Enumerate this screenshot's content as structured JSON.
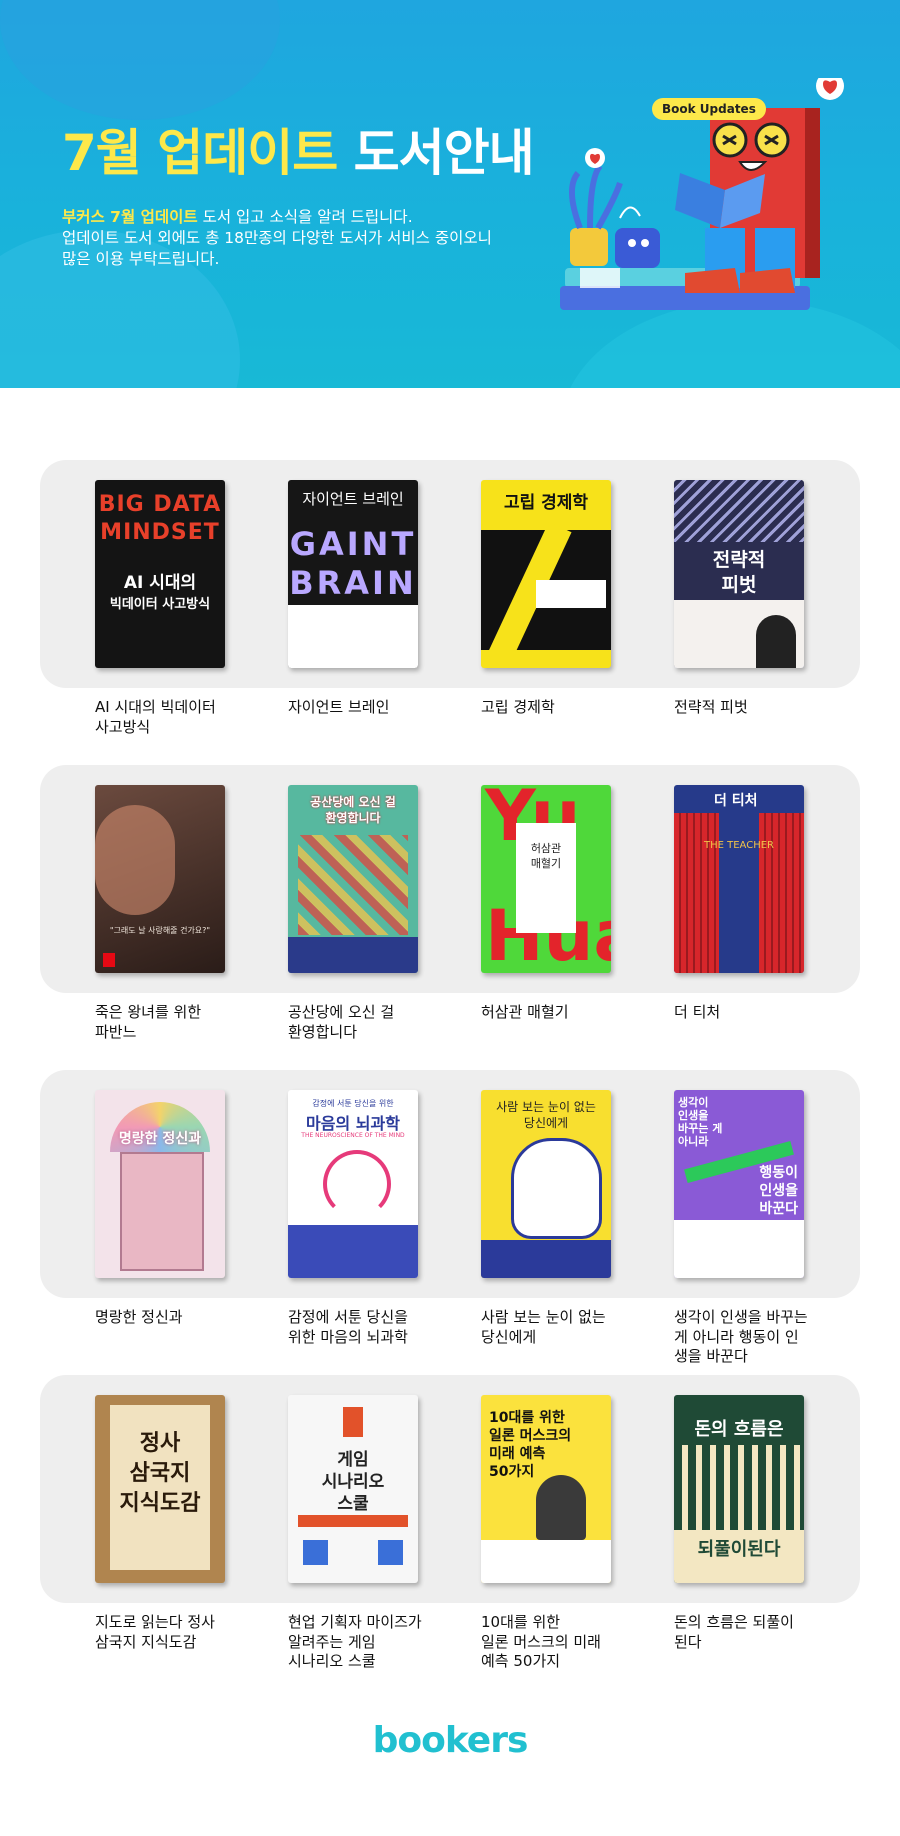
{
  "header": {
    "title_highlight": "7월 업데이트",
    "title_rest": "도서안내",
    "badge": "Book Updates",
    "intro_highlight": "부커스 7월 업데이트",
    "intro_line1_rest": " 도서 입고 소식을 알려 드립니다.",
    "intro_line2": "업데이트 도서 외에도 총 18만종의 다양한 도서가 서비스 중이오니",
    "intro_line3": "많은 이용 부탁드립니다."
  },
  "books": [
    {
      "title_lines": [
        "AI 시대의 빅데이터",
        "사고방식"
      ],
      "cover_text": [
        "BIG DATA",
        "MINDSET",
        "AI 시대의",
        "빅데이터 사고방식"
      ],
      "colors": {
        "bg": "#141414",
        "accent": "#e8402a",
        "text": "#ffffff"
      }
    },
    {
      "title_lines": [
        "자이언트 브레인"
      ],
      "cover_text": [
        "자이언트 브레인",
        "GAINT",
        "BRAIN"
      ],
      "colors": {
        "bg": "#161616",
        "accent": "#a8a8ff",
        "text": "#ffffff"
      }
    },
    {
      "title_lines": [
        "고립 경제학"
      ],
      "cover_text": [
        "고립 경제학"
      ],
      "colors": {
        "bg": "#f7e21a",
        "accent": "#111111",
        "text": "#111111"
      }
    },
    {
      "title_lines": [
        "전략적 피벗"
      ],
      "cover_text": [
        "전략적",
        "피벗"
      ],
      "colors": {
        "bg": "#2b2d50",
        "accent": "#c9c9e8",
        "text": "#ffffff"
      }
    },
    {
      "title_lines": [
        "죽은 왕녀를 위한",
        "파반느"
      ],
      "cover_text": [
        "\"그래도 날 사랑해줄 건가요?\""
      ],
      "colors": {
        "bg": "#3a2a26",
        "accent": "#c87a5a",
        "text": "#f0e6dc"
      }
    },
    {
      "title_lines": [
        "공산당에 오신 걸",
        "환영합니다"
      ],
      "cover_text": [
        "공산당에 오신 걸",
        "환영합니다"
      ],
      "colors": {
        "bg": "#57b89f",
        "accent": "#e1453d",
        "text": "#ffffff"
      }
    },
    {
      "title_lines": [
        "허삼관 매혈기"
      ],
      "cover_text": [
        "Yu",
        "Hua",
        "허삼관",
        "매혈기"
      ],
      "colors": {
        "bg": "#4fd83a",
        "accent": "#e3242b",
        "text": "#222222"
      }
    },
    {
      "title_lines": [
        "더 티처"
      ],
      "cover_text": [
        "더 티처",
        "THE TEACHER"
      ],
      "colors": {
        "bg": "#263a8a",
        "accent": "#d7262b",
        "text": "#ffffff"
      }
    },
    {
      "title_lines": [
        "명랑한 정신과"
      ],
      "cover_text": [
        "명랑한 정신과"
      ],
      "colors": {
        "bg": "#f3e3ea",
        "accent": "#e07aa0",
        "text": "#5a3a4a"
      }
    },
    {
      "title_lines": [
        "감정에 서툰 당신을",
        "위한 마음의 뇌과학"
      ],
      "cover_text": [
        "감정에 서툰 당신을 위한",
        "마음의 뇌과학",
        "THE NEUROSCIENCE OF THE MIND"
      ],
      "colors": {
        "bg": "#ffffff",
        "accent": "#3a4bb8",
        "text": "#2a3a9a"
      }
    },
    {
      "title_lines": [
        "사람 보는 눈이 없는",
        "당신에게"
      ],
      "cover_text": [
        "사람 보는 눈이 없는",
        "당신에게"
      ],
      "colors": {
        "bg": "#f8df2f",
        "accent": "#2b3a9a",
        "text": "#222222"
      }
    },
    {
      "title_lines": [
        "생각이 인생을 바꾸는",
        "게 아니라 행동이 인",
        "생을 바꾼다"
      ],
      "cover_text": [
        "생각이",
        "인생을",
        "바꾸는 게",
        "아니라",
        "행동이",
        "인생을",
        "바꾼다"
      ],
      "colors": {
        "bg": "#8a5ad6",
        "accent": "#2cc95a",
        "text": "#ffffff"
      }
    },
    {
      "title_lines": [
        "지도로 읽는다 정사",
        "삼국지 지식도감"
      ],
      "cover_text": [
        "정사",
        "삼국지",
        "지식도감"
      ],
      "colors": {
        "bg": "#b0854f",
        "accent": "#f1e2c0",
        "text": "#2a1a0a"
      }
    },
    {
      "title_lines": [
        "현업 기획자 마이즈가",
        "알려주는 게임",
        "시나리오 스쿨"
      ],
      "cover_text": [
        "게임",
        "시나리오",
        "스쿨"
      ],
      "colors": {
        "bg": "#f7f7f7",
        "accent": "#e2522a",
        "text": "#222222"
      }
    },
    {
      "title_lines": [
        "10대를 위한",
        "일론 머스크의 미래",
        "예측 50가지"
      ],
      "cover_text": [
        "10대를 위한",
        "일론 머스크의",
        "미래 예측",
        "50가지"
      ],
      "colors": {
        "bg": "#fbe23d",
        "accent": "#2a2a2a",
        "text": "#111111"
      }
    },
    {
      "title_lines": [
        "돈의 흐름은 되풀이",
        "된다"
      ],
      "cover_text": [
        "돈의 흐름은",
        "되풀이된다"
      ],
      "colors": {
        "bg": "#1f4a36",
        "accent": "#f3e7c2",
        "text": "#ffffff"
      }
    }
  ],
  "footer": {
    "logo": "bookers"
  }
}
